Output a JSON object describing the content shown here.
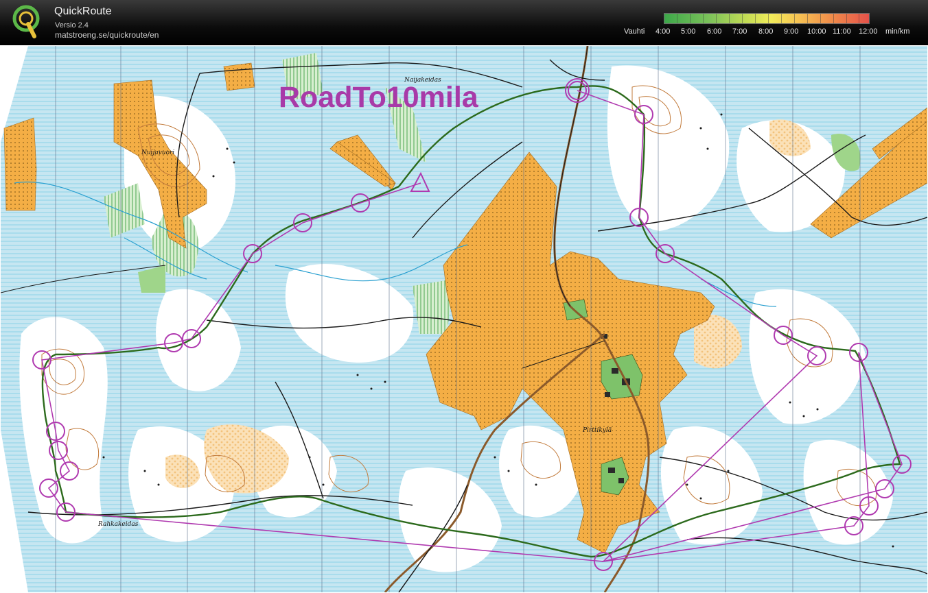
{
  "header": {
    "app_title": "QuickRoute",
    "version": "Versio 2.4",
    "url": "matstroeng.se/quickroute/en",
    "logo_icon": "quickroute-logo-icon"
  },
  "speed_legend": {
    "label": "Vauhti",
    "ticks": [
      "4:00",
      "5:00",
      "6:00",
      "7:00",
      "8:00",
      "9:00",
      "10:00",
      "11:00",
      "12:00"
    ],
    "unit": "min/km",
    "colors": [
      "#3da84a",
      "#7cc25a",
      "#c3dc55",
      "#f2ec5a",
      "#f6c453",
      "#f08b4a",
      "#e5524a"
    ]
  },
  "map": {
    "overlay_title": "RoadTo10mila",
    "place_names": [
      "Naijakeidas",
      "Nuijavuori",
      "Pirttikylä",
      "Rahkakeidas"
    ],
    "colors": {
      "water": "#c6e6f1",
      "open_land": "#f4ae45",
      "forest": "#ffffff",
      "green": "#7ec26a",
      "contour": "#c27b3c",
      "route": "#2c6a1c",
      "course": "#b03ab0",
      "title": "#a83aa8"
    }
  }
}
